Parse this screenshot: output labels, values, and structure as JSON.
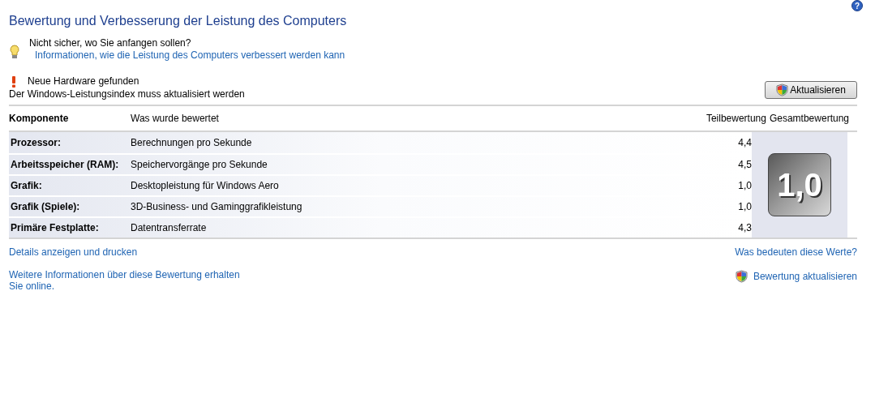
{
  "help_icon": "?",
  "title": "Bewertung und Verbesserung der Leistung des Computers",
  "tip": {
    "heading": "Nicht sicher, wo Sie anfangen sollen?",
    "link": "Informationen, wie die Leistung des Computers verbessert werden kann"
  },
  "notice": {
    "heading": "Neue Hardware gefunden",
    "message": "Der Windows-Leistungsindex muss aktualisiert werden",
    "button": "Aktualisieren"
  },
  "table": {
    "columns": [
      "Komponente",
      "Was wurde bewertet",
      "Teilbewertung",
      "Gesamtbewertung"
    ],
    "rows": [
      {
        "component": "Prozessor:",
        "rated": "Berechnungen pro Sekunde",
        "subscore": "4,4"
      },
      {
        "component": "Arbeitsspeicher (RAM):",
        "rated": "Speichervorgänge pro Sekunde",
        "subscore": "4,5"
      },
      {
        "component": "Grafik:",
        "rated": "Desktopleistung für Windows Aero",
        "subscore": "1,0"
      },
      {
        "component": "Grafik (Spiele):",
        "rated": "3D-Business- und Gaminggrafikleistung",
        "subscore": "1,0"
      },
      {
        "component": "Primäre Festplatte:",
        "rated": "Datentransferrate",
        "subscore": "4,3"
      }
    ],
    "base_score": "1,0"
  },
  "links_left": [
    "Details anzeigen und drucken",
    "Weitere Informationen über diese Bewertung erhalten",
    "Sie online."
  ],
  "links_right": [
    "Was bedeuten diese Werte?",
    "Bewertung aktualisieren"
  ]
}
